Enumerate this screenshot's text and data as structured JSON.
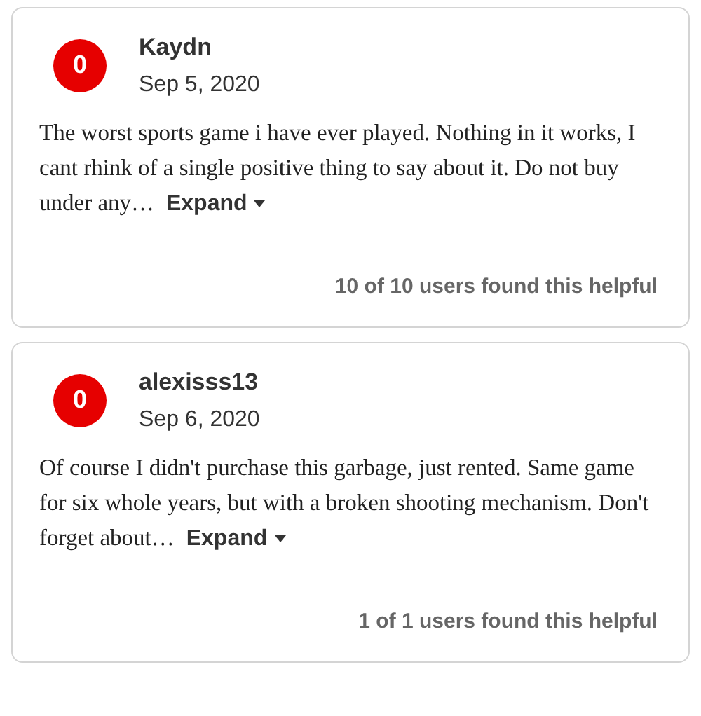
{
  "reviews": [
    {
      "score": "0",
      "username": "Kaydn",
      "date": "Sep 5, 2020",
      "text": "The worst sports game i have ever played. Nothing in it works, I cant rhink of a single positive thing to say about it. Do not buy under any…",
      "expand": "Expand",
      "helpful": "10 of 10 users found this helpful"
    },
    {
      "score": "0",
      "username": "alexisss13",
      "date": "Sep 6, 2020",
      "text": "Of course I didn't purchase this garbage, just rented. Same game for six whole years, but with a broken shooting mechanism. Don't forget about…",
      "expand": "Expand",
      "helpful": "1 of 1 users found this helpful"
    }
  ]
}
